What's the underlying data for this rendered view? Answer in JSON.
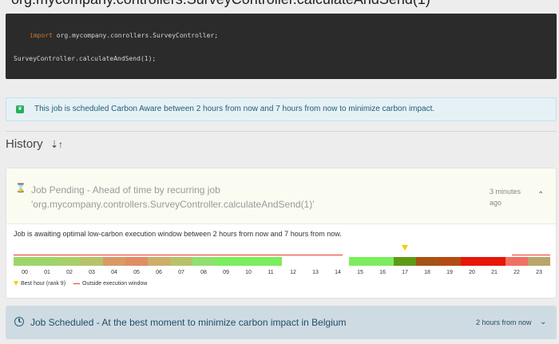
{
  "job": {
    "title": "org.mycompany.controllers.SurveyController.calculateAndSend(1)"
  },
  "code": {
    "keyword": "import",
    "import_path": " org.mycompany.conrollers.SurveyController;",
    "call": "SurveyController.calculateAndSend(1);"
  },
  "info_banner": {
    "text": "This job is scheduled Carbon Aware between 2 hours from now and 7 hours from now to minimize carbon impact."
  },
  "history": {
    "title": "History"
  },
  "pending_card": {
    "title_line1": "Job Pending - Ahead of time by recurring job",
    "title_line2": "'org.mycompany.controllers.SurveyController.calculateAndSend(1)'",
    "time_ago": "3 minutes ago",
    "message": "Job is awaiting optimal low-carbon execution window between 2 hours from now and 7 hours from now.",
    "legend_best": "Best hour (rank 9)",
    "legend_outside": "Outside execution window",
    "hours": [
      "00",
      "01",
      "02",
      "03",
      "04",
      "05",
      "06",
      "07",
      "08",
      "09",
      "10",
      "11",
      "12",
      "13",
      "14",
      "15",
      "16",
      "17",
      "18",
      "19",
      "20",
      "21",
      "22",
      "23"
    ],
    "hour_colors": [
      "#9ed56b",
      "#9ed56b",
      "#a9cf6b",
      "#b8c26a",
      "#d99a66",
      "#e08d64",
      "#ccae6b",
      "#b8c26a",
      "#90e070",
      "#7ced5f",
      "#7ced5f",
      "#7ced5f",
      "",
      "",
      "",
      "#7ced5f",
      "#7ced5f",
      "#5f9a17",
      "#a55316",
      "#b24b14",
      "#e8150a",
      "#e8150a",
      "#f07064",
      "#b8a66a"
    ],
    "best_hour_index": 17,
    "window_start_index": 15,
    "window_end_index": 22
  },
  "scheduled_card": {
    "title": "Job Scheduled - At the best moment to minimize carbon impact in Belgium",
    "time": "2 hours from now"
  }
}
